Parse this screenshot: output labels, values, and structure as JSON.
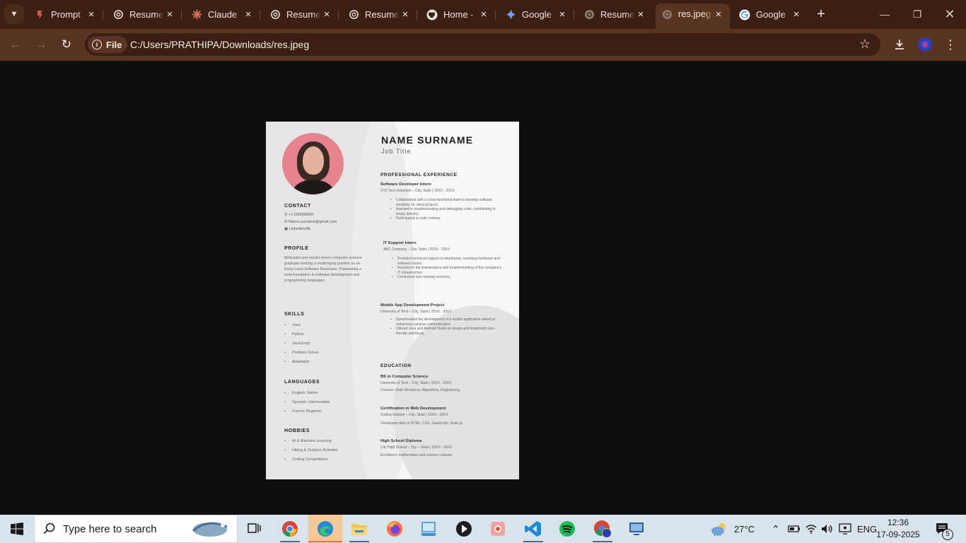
{
  "browser": {
    "tabs": [
      {
        "title": "Prompt",
        "icon": "prompt-favicon",
        "active": false
      },
      {
        "title": "Resume",
        "icon": "chatgpt-favicon",
        "active": false
      },
      {
        "title": "Claude",
        "icon": "claude-favicon",
        "active": false
      },
      {
        "title": "Resume",
        "icon": "chatgpt-favicon",
        "active": false
      },
      {
        "title": "Resume",
        "icon": "chatgpt-favicon",
        "active": false
      },
      {
        "title": "Home -",
        "icon": "github-favicon",
        "active": false
      },
      {
        "title": "Google",
        "icon": "gemini-favicon",
        "active": false
      },
      {
        "title": "Resume",
        "icon": "chatgpt-favicon",
        "active": false
      },
      {
        "title": "res.jpeg",
        "icon": "file-favicon",
        "active": true
      },
      {
        "title": "Google",
        "icon": "google-favicon",
        "active": false
      }
    ],
    "site_chip": "File",
    "url": "C:/Users/PRATHIPA/Downloads/res.jpeg",
    "colors": {
      "frame": "#3a1f12",
      "toolbar": "#5a3422"
    }
  },
  "resume": {
    "name": "NAME SURNAME",
    "job_title": "Job Title",
    "contact": {
      "heading": "CONTACT",
      "phone": "+1 000000000",
      "email": "Name.surname@gmail.com",
      "linkedin": "LinkedinURL"
    },
    "profile": {
      "heading": "PROFILE",
      "text": "Motivated and results-driven computer science graduate seeking a challenging position as an Entry-Level Software Developer. Possessing a solid foundation in software development and programming languages."
    },
    "skills": {
      "heading": "SKILLS",
      "items": [
        "Java",
        "Python",
        "JavaScript",
        "Problem-Solver",
        "Adaptable"
      ]
    },
    "languages": {
      "heading": "LANGUAGES",
      "items": [
        "English: Native",
        "Spanish: Intermediate",
        "French: Beginner"
      ]
    },
    "hobbies": {
      "heading": "HOBBIES",
      "items": [
        "AI & Machine Learning",
        "Hiking & Outdoor Activities",
        "Coding Competitions"
      ]
    },
    "experience": {
      "heading": "PROFESSIONAL EXPERIENCE",
      "jobs": [
        {
          "role": "Software Developer Intern",
          "meta": "XYZ Tech Solutions – City, State | 20XX - 20XX",
          "bullets": [
            "Collaborated with a cross-functional team to develop software solutions for client projects.",
            "Assisted in troubleshooting and debugging code, contributing to timely delivery.",
            "Participated in code reviews."
          ]
        },
        {
          "role": "IT Support Intern",
          "meta": "ABC Company – City, State | 20XX - 20XX",
          "bullets": [
            "Provided technical support to employees, resolving hardware and software issues.",
            "Assisted in the maintenance and troubleshooting of the company's IT infrastructure.",
            "Conducted user training sessions."
          ]
        },
        {
          "role": "Mobile App Development Project",
          "meta": "University of Tech – City, State | 20XX - 20XX",
          "bullets": [
            "Spearheaded the development of a mobile application aimed at enhancing campus communication.",
            "Utilized Java and Android Studio to design and implement user-friendly interfaces."
          ]
        }
      ]
    },
    "education": {
      "heading": "EDUCATION",
      "entries": [
        {
          "degree": "BS in Computer Science",
          "meta": "University of Tech – City, State | 20XX - 20XX",
          "note": "Courses: Data Structures, Algorithms, Engineering."
        },
        {
          "degree": "Certification in Web Development",
          "meta": "Coding Institute – City, State | 20XX - 20XX",
          "note": "Developed skills in HTML, CSS, JavaScript, Node.js."
        },
        {
          "degree": "High School Diploma",
          "meta": "City High School – City – State | 20XX - 20XX",
          "note": "Excelled in mathematics and science courses."
        }
      ]
    }
  },
  "taskbar": {
    "search_placeholder": "Type here to search",
    "apps": [
      "task-view",
      "chrome",
      "edge",
      "file-explorer",
      "firefox",
      "desktop-app",
      "media-player",
      "photo-app",
      "vscode",
      "spotify",
      "chrome-profile",
      "remote-desktop"
    ],
    "weather": "27°C",
    "language": "ENG",
    "time": "12:36",
    "date": "17-09-2025",
    "notifications": "5"
  }
}
